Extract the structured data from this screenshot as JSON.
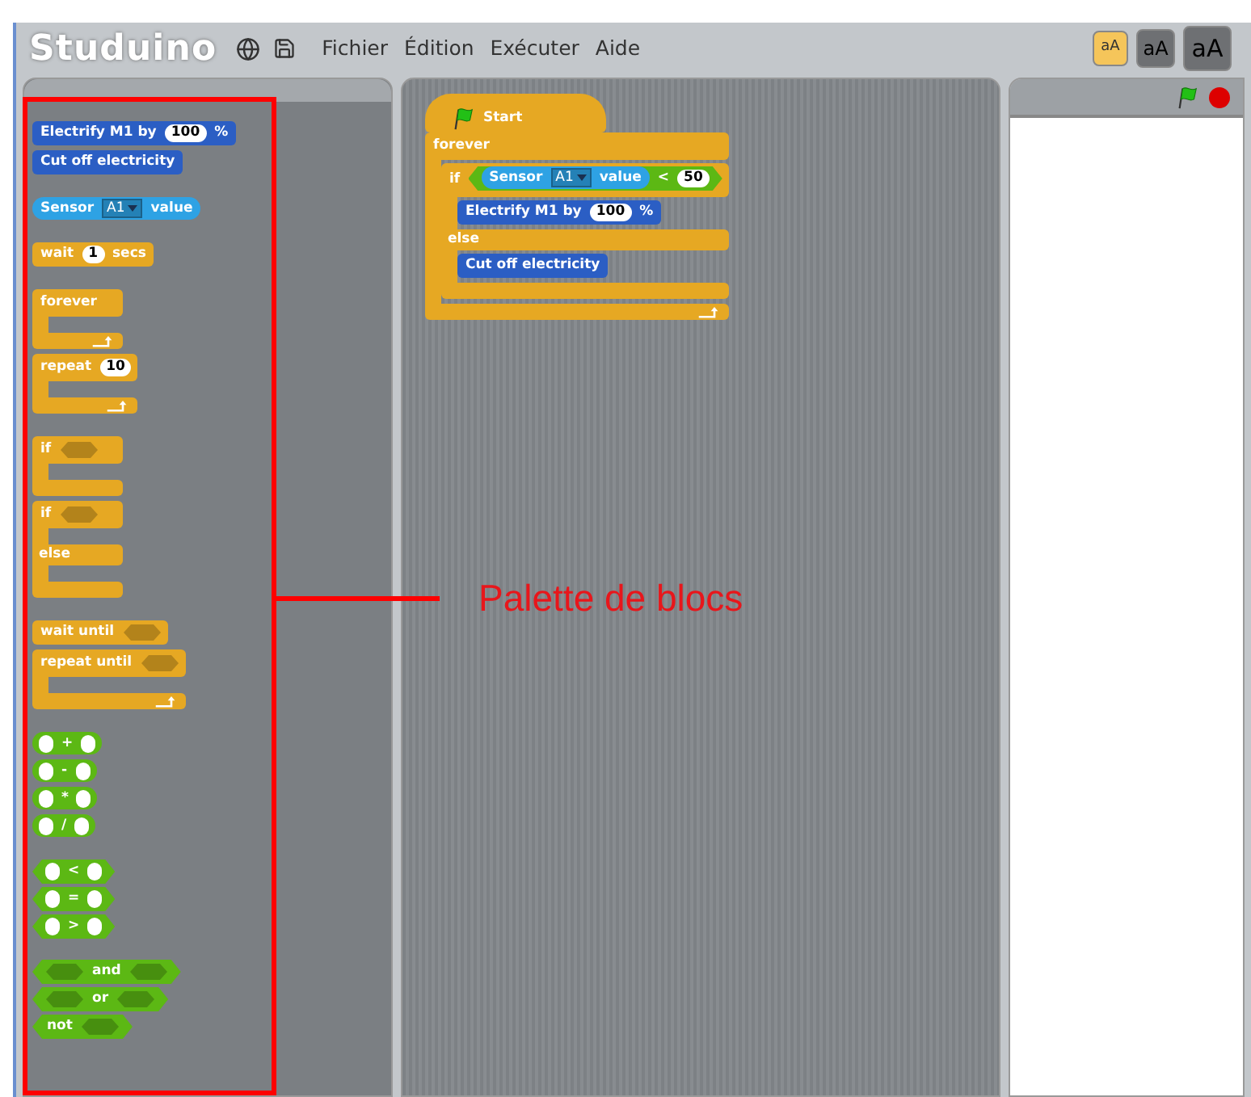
{
  "header": {
    "logo": "Studuino",
    "menu": [
      "Fichier",
      "Édition",
      "Exécuter",
      "Aide"
    ],
    "size_buttons": [
      {
        "label": "aA",
        "selected": true
      },
      {
        "label": "aA",
        "selected": false
      },
      {
        "label": "aA",
        "selected": false
      }
    ]
  },
  "palette": {
    "groups": [
      [
        {
          "kind": "stack",
          "color": "#2b5ec4",
          "parts": [
            {
              "kind": "text",
              "text": "Electrify M1 by"
            },
            {
              "kind": "number",
              "text": "100"
            },
            {
              "kind": "text",
              "text": "%"
            }
          ]
        },
        {
          "kind": "stack",
          "color": "#2b5ec4",
          "parts": [
            {
              "kind": "text",
              "text": "Cut off electricity"
            }
          ]
        }
      ],
      [
        {
          "kind": "reporter",
          "color": "#2ea2e4",
          "parts": [
            {
              "kind": "text",
              "text": "Sensor"
            },
            {
              "kind": "dropdown",
              "text": "A1"
            },
            {
              "kind": "text",
              "text": "value"
            }
          ]
        }
      ],
      [
        {
          "kind": "stack",
          "color": "#e6a823",
          "parts": [
            {
              "kind": "text",
              "text": "wait"
            },
            {
              "kind": "number",
              "text": "1"
            },
            {
              "kind": "text",
              "text": "secs"
            }
          ]
        }
      ],
      [
        {
          "kind": "c_loop",
          "color": "#e6a823",
          "parts": [
            {
              "kind": "text",
              "text": "forever"
            }
          ]
        },
        {
          "kind": "c_loop",
          "color": "#e6a823",
          "parts": [
            {
              "kind": "text",
              "text": "repeat"
            },
            {
              "kind": "number",
              "text": "10"
            }
          ]
        }
      ],
      [
        {
          "kind": "c_if",
          "color": "#e6a823",
          "parts": [
            {
              "kind": "text",
              "text": "if"
            },
            {
              "kind": "bool_slot"
            }
          ]
        },
        {
          "kind": "c_if_else",
          "color": "#e6a823",
          "parts": [
            {
              "kind": "text",
              "text": "if"
            },
            {
              "kind": "bool_slot"
            }
          ],
          "else_label": "else"
        }
      ],
      [
        {
          "kind": "stack",
          "color": "#e6a823",
          "parts": [
            {
              "kind": "text",
              "text": "wait until"
            },
            {
              "kind": "bool_slot"
            }
          ]
        },
        {
          "kind": "c_loop",
          "color": "#e6a823",
          "parts": [
            {
              "kind": "text",
              "text": "repeat until"
            },
            {
              "kind": "bool_slot"
            }
          ]
        }
      ],
      [
        {
          "kind": "reporter",
          "color": "#5cb814",
          "parts": [
            {
              "kind": "round_slot"
            },
            {
              "kind": "text",
              "text": "+"
            },
            {
              "kind": "round_slot"
            }
          ]
        },
        {
          "kind": "reporter",
          "color": "#5cb814",
          "parts": [
            {
              "kind": "round_slot"
            },
            {
              "kind": "text",
              "text": "-"
            },
            {
              "kind": "round_slot"
            }
          ]
        },
        {
          "kind": "reporter",
          "color": "#5cb814",
          "parts": [
            {
              "kind": "round_slot"
            },
            {
              "kind": "text",
              "text": "*"
            },
            {
              "kind": "round_slot"
            }
          ]
        },
        {
          "kind": "reporter",
          "color": "#5cb814",
          "parts": [
            {
              "kind": "round_slot"
            },
            {
              "kind": "text",
              "text": "/"
            },
            {
              "kind": "round_slot"
            }
          ]
        }
      ],
      [
        {
          "kind": "boolean",
          "color": "#5cb814",
          "parts": [
            {
              "kind": "round_slot"
            },
            {
              "kind": "text",
              "text": "<"
            },
            {
              "kind": "round_slot"
            }
          ]
        },
        {
          "kind": "boolean",
          "color": "#5cb814",
          "parts": [
            {
              "kind": "round_slot"
            },
            {
              "kind": "text",
              "text": "="
            },
            {
              "kind": "round_slot"
            }
          ]
        },
        {
          "kind": "boolean",
          "color": "#5cb814",
          "parts": [
            {
              "kind": "round_slot"
            },
            {
              "kind": "text",
              "text": ">"
            },
            {
              "kind": "round_slot"
            }
          ]
        }
      ],
      [
        {
          "kind": "boolean",
          "color": "#5cb814",
          "parts": [
            {
              "kind": "bool_slot"
            },
            {
              "kind": "text",
              "text": "and"
            },
            {
              "kind": "bool_slot"
            }
          ]
        },
        {
          "kind": "boolean",
          "color": "#5cb814",
          "parts": [
            {
              "kind": "bool_slot"
            },
            {
              "kind": "text",
              "text": "or"
            },
            {
              "kind": "bool_slot"
            }
          ]
        },
        {
          "kind": "boolean",
          "color": "#5cb814",
          "parts": [
            {
              "kind": "text",
              "text": "not"
            },
            {
              "kind": "bool_slot"
            }
          ]
        }
      ]
    ]
  },
  "script": [
    {
      "kind": "hat",
      "color": "#e6a823",
      "parts": [
        {
          "kind": "text",
          "text": "Start"
        }
      ]
    },
    {
      "kind": "c_loop",
      "color": "#e6a823",
      "parts": [
        {
          "kind": "text",
          "text": "forever"
        }
      ],
      "children": [
        {
          "kind": "c_if_else",
          "color": "#e6a823",
          "parts": [
            {
              "kind": "text",
              "text": "if"
            },
            {
              "kind": "boolean",
              "color": "#5cb814",
              "parts": [
                {
                  "kind": "reporter",
                  "color": "#2ea2e4",
                  "parts": [
                    {
                      "kind": "text",
                      "text": "Sensor"
                    },
                    {
                      "kind": "dropdown",
                      "text": "A1"
                    },
                    {
                      "kind": "text",
                      "text": "value"
                    }
                  ]
                },
                {
                  "kind": "text",
                  "text": "<"
                },
                {
                  "kind": "number",
                  "text": "50"
                }
              ]
            }
          ],
          "else_label": "else",
          "children": [
            {
              "kind": "stack",
              "color": "#2b5ec4",
              "parts": [
                {
                  "kind": "text",
                  "text": "Electrify M1 by"
                },
                {
                  "kind": "number",
                  "text": "100"
                },
                {
                  "kind": "text",
                  "text": "%"
                }
              ]
            }
          ],
          "else_children": [
            {
              "kind": "stack",
              "color": "#2b5ec4",
              "parts": [
                {
                  "kind": "text",
                  "text": "Cut off electricity"
                }
              ]
            }
          ]
        }
      ]
    }
  ],
  "annotation": {
    "label": "Palette de blocs"
  }
}
